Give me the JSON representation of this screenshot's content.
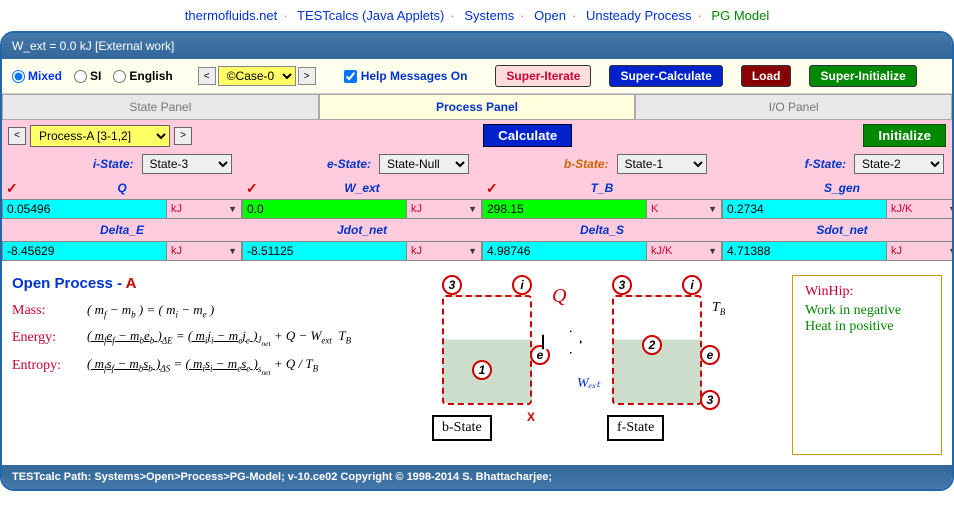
{
  "breadcrumb": {
    "items": [
      "thermofluids.net",
      "TESTcalcs (Java Applets)",
      "Systems",
      "Open",
      "Unsteady Process"
    ],
    "current": "PG Model"
  },
  "titlebar": "W_ext = 0.0  kJ [External work]",
  "toolbar": {
    "units": {
      "mixed": "Mixed",
      "si": "SI",
      "english": "English"
    },
    "case": "©Case-0",
    "help_label": "Help Messages On",
    "super_iterate": "Super-Iterate",
    "super_calculate": "Super-Calculate",
    "load": "Load",
    "super_initialize": "Super-Initialize"
  },
  "tabs": {
    "state": "State Panel",
    "process": "Process Panel",
    "io": "I/O Panel"
  },
  "procbar": {
    "process": "Process-A [3-1,2]",
    "calculate": "Calculate",
    "initialize": "Initialize"
  },
  "states": {
    "i": {
      "label": "i-State:",
      "value": "State-3"
    },
    "e": {
      "label": "e-State:",
      "value": "State-Null"
    },
    "b": {
      "label": "b-State:",
      "value": "State-1"
    },
    "f": {
      "label": "f-State:",
      "value": "State-2"
    }
  },
  "vars": {
    "Q": {
      "name": "Q",
      "value": "0.05496",
      "unit": "kJ",
      "check": true,
      "color": "cyan"
    },
    "W_ext": {
      "name": "W_ext",
      "value": "0.0",
      "unit": "kJ",
      "check": true,
      "color": "green"
    },
    "T_B": {
      "name": "T_B",
      "value": "298.15",
      "unit": "K",
      "check": true,
      "color": "green"
    },
    "S_gen": {
      "name": "S_gen",
      "value": "0.2734",
      "unit": "kJ/K",
      "check": false,
      "color": "cyan"
    },
    "Delta_E": {
      "name": "Delta_E",
      "value": "-8.45629",
      "unit": "kJ",
      "check": false,
      "color": "cyan"
    },
    "Jdot_net": {
      "name": "Jdot_net",
      "value": "-8.51125",
      "unit": "kJ",
      "check": false,
      "color": "cyan"
    },
    "Delta_S": {
      "name": "Delta_S",
      "value": "4.98746",
      "unit": "kJ/K",
      "check": false,
      "color": "cyan"
    },
    "Sdot_net": {
      "name": "Sdot_net",
      "value": "4.71388",
      "unit": "kJ",
      "check": false,
      "color": "cyan"
    }
  },
  "diagram": {
    "title": "Open Process - ",
    "title_suffix": "A",
    "mass_label": "Mass:",
    "energy_label": "Energy:",
    "entropy_label": "Entropy:",
    "b_state": "b-State",
    "f_state": "f-State",
    "Q": "Q",
    "W": "Wₑₓₜ",
    "TB": "T_B",
    "X": "X",
    "hint_title": "WinHip:",
    "hint_l1": "Work in negative",
    "hint_l2": "Heat in positive"
  },
  "footer": "TESTcalc Path:  Systems>Open>Process>PG-Model; v-10.ce02 Copyright © 1998-2014 S. Bhattacharjee;"
}
